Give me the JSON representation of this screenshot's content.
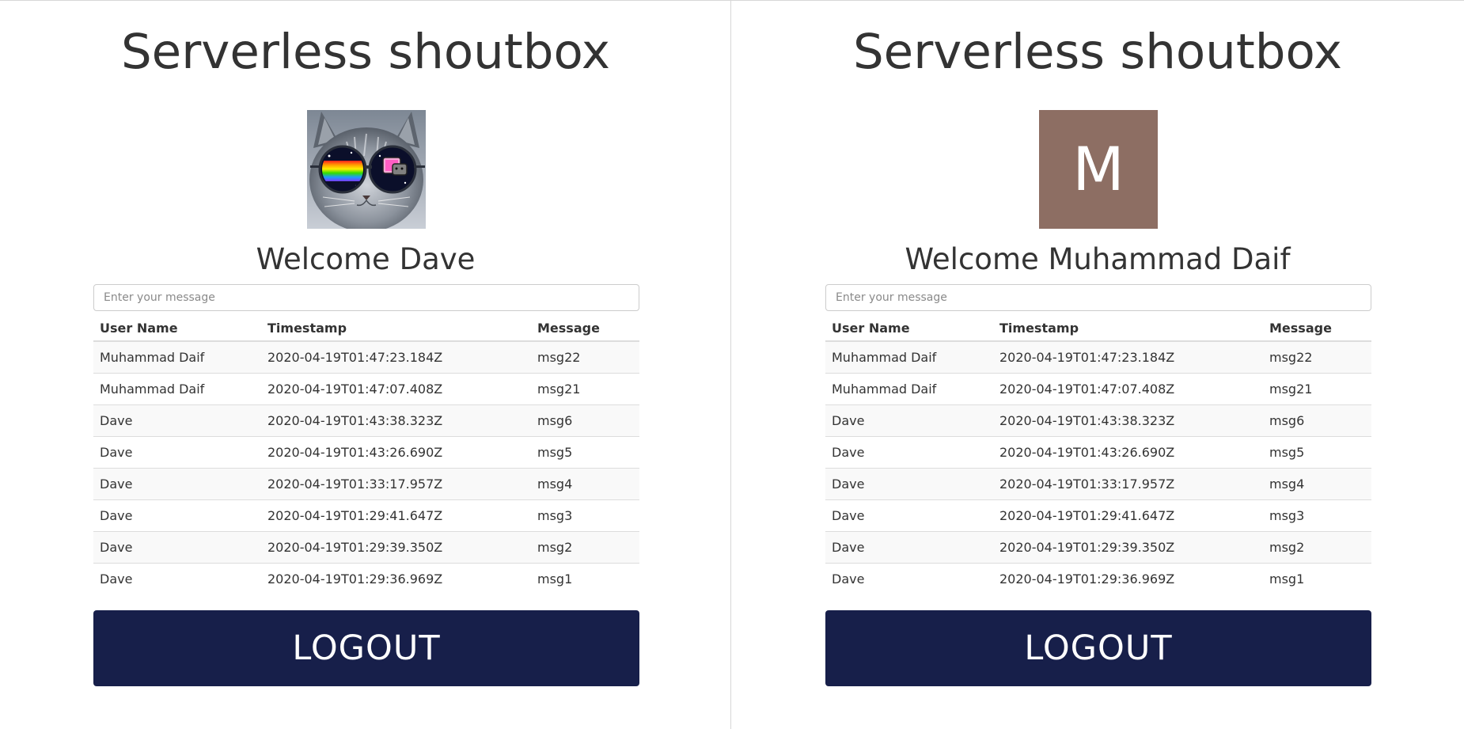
{
  "panes": [
    {
      "title": "Serverless shoutbox",
      "avatar": {
        "kind": "photo",
        "description_icon": "cat-with-sunglasses-avatar"
      },
      "welcome": "Welcome Dave",
      "input": {
        "placeholder": "Enter your message",
        "value": ""
      },
      "table": {
        "headers": [
          "User Name",
          "Timestamp",
          "Message"
        ],
        "rows": [
          [
            "Muhammad Daif",
            "2020-04-19T01:47:23.184Z",
            "msg22"
          ],
          [
            "Muhammad Daif",
            "2020-04-19T01:47:07.408Z",
            "msg21"
          ],
          [
            "Dave",
            "2020-04-19T01:43:38.323Z",
            "msg6"
          ],
          [
            "Dave",
            "2020-04-19T01:43:26.690Z",
            "msg5"
          ],
          [
            "Dave",
            "2020-04-19T01:33:17.957Z",
            "msg4"
          ],
          [
            "Dave",
            "2020-04-19T01:29:41.647Z",
            "msg3"
          ],
          [
            "Dave",
            "2020-04-19T01:29:39.350Z",
            "msg2"
          ],
          [
            "Dave",
            "2020-04-19T01:29:36.969Z",
            "msg1"
          ]
        ]
      },
      "logout_label": "LOGOUT"
    },
    {
      "title": "Serverless shoutbox",
      "avatar": {
        "kind": "letter",
        "letter": "M",
        "color": "#8d6e63"
      },
      "welcome": "Welcome Muhammad Daif",
      "input": {
        "placeholder": "Enter your message",
        "value": ""
      },
      "table": {
        "headers": [
          "User Name",
          "Timestamp",
          "Message"
        ],
        "rows": [
          [
            "Muhammad Daif",
            "2020-04-19T01:47:23.184Z",
            "msg22"
          ],
          [
            "Muhammad Daif",
            "2020-04-19T01:47:07.408Z",
            "msg21"
          ],
          [
            "Dave",
            "2020-04-19T01:43:38.323Z",
            "msg6"
          ],
          [
            "Dave",
            "2020-04-19T01:43:26.690Z",
            "msg5"
          ],
          [
            "Dave",
            "2020-04-19T01:33:17.957Z",
            "msg4"
          ],
          [
            "Dave",
            "2020-04-19T01:29:41.647Z",
            "msg3"
          ],
          [
            "Dave",
            "2020-04-19T01:29:39.350Z",
            "msg2"
          ],
          [
            "Dave",
            "2020-04-19T01:29:36.969Z",
            "msg1"
          ]
        ]
      },
      "logout_label": "LOGOUT"
    }
  ],
  "colors": {
    "logout_bg": "#171f4a",
    "text": "#333333",
    "stripe": "#f9f9f9"
  }
}
